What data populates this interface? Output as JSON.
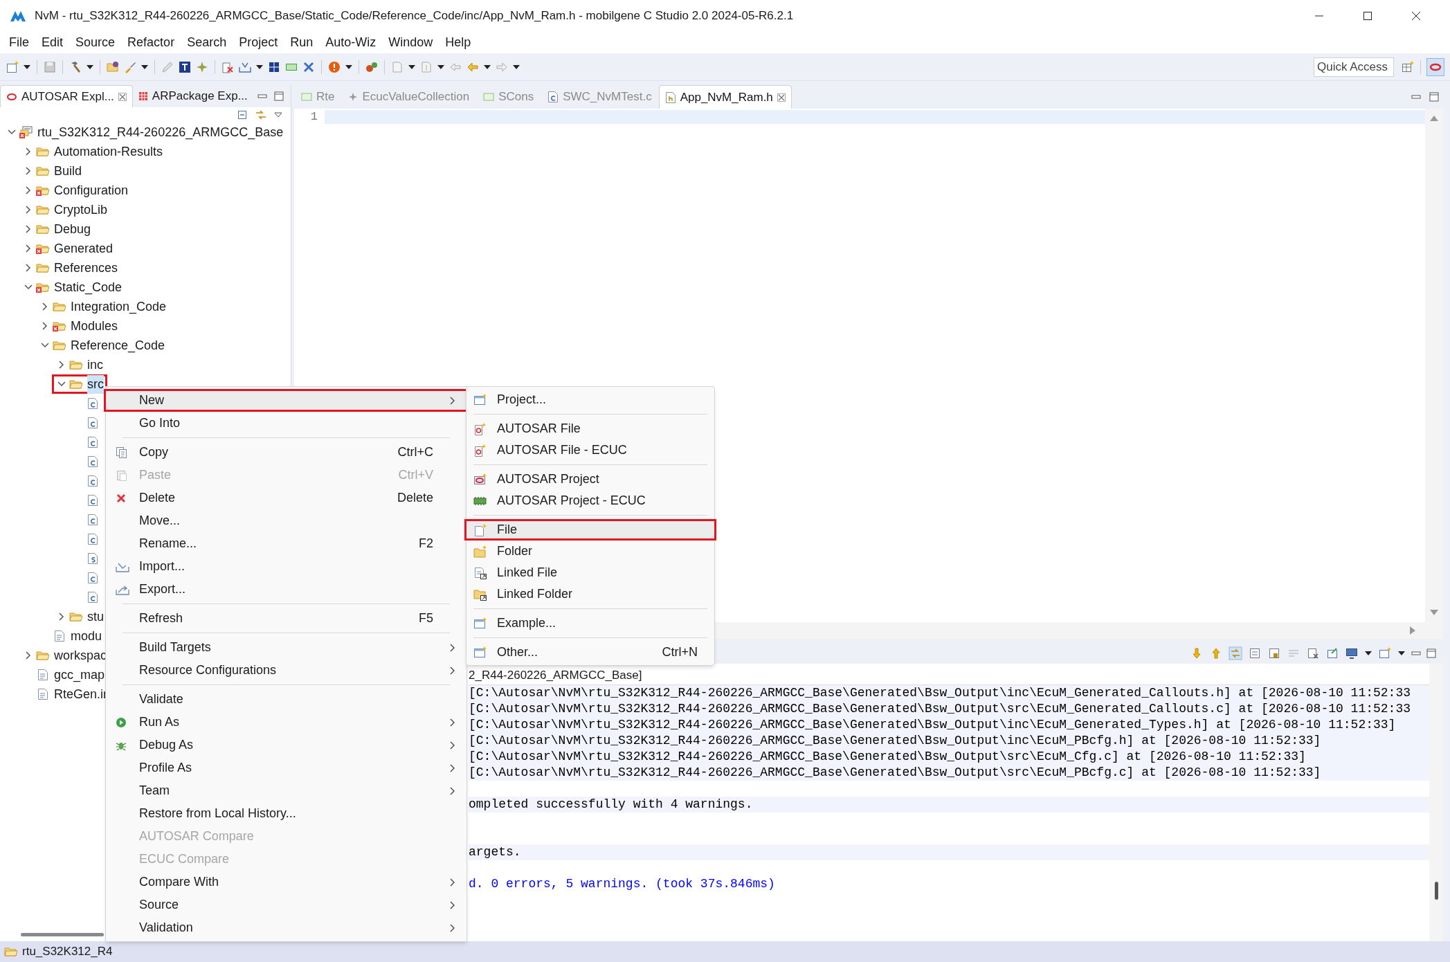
{
  "window": {
    "title": "NvM - rtu_S32K312_R44-260226_ARMGCC_Base/Static_Code/Reference_Code/inc/App_NvM_Ram.h - mobilgene C Studio 2.0 2024-05-R6.2.1"
  },
  "menu_bar": [
    "File",
    "Edit",
    "Source",
    "Refactor",
    "Search",
    "Project",
    "Run",
    "Auto-Wiz",
    "Window",
    "Help"
  ],
  "quick_access": {
    "placeholder": "Quick Access"
  },
  "left_panel": {
    "tabs": [
      {
        "label": "AUTOSAR Expl...",
        "selected": true
      },
      {
        "label": "ARPackage Exp...",
        "selected": false
      }
    ],
    "tree": [
      {
        "label": "rtu_S32K312_R44-260226_ARMGCC_Base",
        "kind": "project",
        "expanded": true,
        "error": true,
        "highlighted": false,
        "children": [
          {
            "label": "Automation-Results",
            "kind": "folder",
            "expanded": false,
            "error": false,
            "highlighted": false
          },
          {
            "label": "Build",
            "kind": "folder",
            "expanded": false,
            "error": false,
            "highlighted": false
          },
          {
            "label": "Configuration",
            "kind": "folder",
            "expanded": false,
            "error": true,
            "highlighted": false
          },
          {
            "label": "CryptoLib",
            "kind": "folder",
            "expanded": false,
            "error": false,
            "highlighted": false
          },
          {
            "label": "Debug",
            "kind": "folder",
            "expanded": false,
            "error": false,
            "highlighted": false
          },
          {
            "label": "Generated",
            "kind": "folder",
            "expanded": false,
            "error": true,
            "highlighted": false
          },
          {
            "label": "References",
            "kind": "folder",
            "expanded": false,
            "error": false,
            "highlighted": false
          },
          {
            "label": "Static_Code",
            "kind": "folder",
            "expanded": true,
            "error": true,
            "highlighted": false,
            "children": [
              {
                "label": "Integration_Code",
                "kind": "folder",
                "expanded": false,
                "error": false,
                "highlighted": false
              },
              {
                "label": "Modules",
                "kind": "folder",
                "expanded": false,
                "error": true,
                "highlighted": false
              },
              {
                "label": "Reference_Code",
                "kind": "folder",
                "expanded": true,
                "error": false,
                "highlighted": false,
                "children": [
                  {
                    "label": "inc",
                    "kind": "folder",
                    "expanded": false,
                    "error": false,
                    "highlighted": false
                  },
                  {
                    "label": "src",
                    "kind": "folder",
                    "expanded": true,
                    "error": false,
                    "highlighted": true,
                    "children": [
                      {
                        "kind": "c_file",
                        "highlighted": false
                      },
                      {
                        "kind": "c_file",
                        "highlighted": false
                      },
                      {
                        "kind": "c_file",
                        "highlighted": false
                      },
                      {
                        "kind": "c_file",
                        "highlighted": false
                      },
                      {
                        "kind": "c_file",
                        "highlighted": false
                      },
                      {
                        "kind": "c_file",
                        "highlighted": false
                      },
                      {
                        "kind": "c_file",
                        "highlighted": false
                      },
                      {
                        "kind": "c_file",
                        "highlighted": false
                      },
                      {
                        "kind": "asm_file",
                        "highlighted": false
                      },
                      {
                        "kind": "c_file",
                        "highlighted": false
                      },
                      {
                        "kind": "c_file",
                        "highlighted": false
                      }
                    ]
                  },
                  {
                    "label": "stu",
                    "kind": "folder",
                    "expanded": false,
                    "error": false,
                    "highlighted": false
                  }
                ]
              },
              {
                "label": "modu",
                "kind": "file",
                "highlighted": false
              }
            ]
          },
          {
            "label": "workspac",
            "kind": "folder",
            "expanded": false,
            "error": false,
            "highlighted": false
          },
          {
            "label": "gcc_map",
            "kind": "file",
            "highlighted": false
          },
          {
            "label": "RteGen.ir",
            "kind": "file",
            "highlighted": false
          }
        ]
      }
    ]
  },
  "editor": {
    "tabs": [
      {
        "label": "Rte",
        "selected": false
      },
      {
        "label": "EcucValueCollection",
        "selected": false
      },
      {
        "label": "SCons",
        "selected": false
      },
      {
        "label": "SWC_NvMTest.c",
        "selected": false
      },
      {
        "label": "App_NvM_Ram.h",
        "selected": true
      }
    ],
    "line_numbers": [
      "1"
    ]
  },
  "console": {
    "title": "2_R44-260226_ARMGCC_Base]",
    "lines": [
      {
        "kind": "text",
        "text": "[C:\\Autosar\\NvM\\rtu_S32K312_R44-260226_ARMGCC_Base\\Generated\\Bsw_Output\\inc\\EcuM_Generated_Callouts.h] at [2026-08-10 11:52:33",
        "shaded": true,
        "color": "#000000"
      },
      {
        "kind": "text",
        "text": "[C:\\Autosar\\NvM\\rtu_S32K312_R44-260226_ARMGCC_Base\\Generated\\Bsw_Output\\src\\EcuM_Generated_Callouts.c] at [2026-08-10 11:52:33",
        "shaded": true,
        "color": "#000000"
      },
      {
        "kind": "text",
        "text": "[C:\\Autosar\\NvM\\rtu_S32K312_R44-260226_ARMGCC_Base\\Generated\\Bsw_Output\\inc\\EcuM_Generated_Types.h] at [2026-08-10 11:52:33]",
        "shaded": true,
        "color": "#000000"
      },
      {
        "kind": "text",
        "text": "[C:\\Autosar\\NvM\\rtu_S32K312_R44-260226_ARMGCC_Base\\Generated\\Bsw_Output\\inc\\EcuM_PBcfg.h] at [2026-08-10 11:52:33]",
        "shaded": true,
        "color": "#000000"
      },
      {
        "kind": "text",
        "text": "[C:\\Autosar\\NvM\\rtu_S32K312_R44-260226_ARMGCC_Base\\Generated\\Bsw_Output\\src\\EcuM_Cfg.c] at [2026-08-10 11:52:33]",
        "shaded": true,
        "color": "#000000"
      },
      {
        "kind": "text",
        "text": "[C:\\Autosar\\NvM\\rtu_S32K312_R44-260226_ARMGCC_Base\\Generated\\Bsw_Output\\src\\EcuM_PBcfg.c] at [2026-08-10 11:52:33]",
        "shaded": true,
        "color": "#000000"
      },
      {
        "kind": "blank"
      },
      {
        "kind": "text",
        "text": "ompleted successfully with 4 warnings.",
        "shaded": true,
        "color": "#000000"
      },
      {
        "kind": "blank"
      },
      {
        "kind": "blank"
      },
      {
        "kind": "text",
        "text": "argets.",
        "shaded": true,
        "color": "#000000"
      },
      {
        "kind": "blank"
      },
      {
        "kind": "text",
        "text": "d. 0 errors, 5 warnings. (took 37s.846ms)",
        "shaded": false,
        "color": "#0000ff"
      }
    ]
  },
  "context_menu": [
    {
      "kind": "item",
      "label": "New",
      "submenu": true,
      "disabled": false,
      "highlighted": true
    },
    {
      "kind": "item",
      "label": "Go Into",
      "submenu": false,
      "disabled": false,
      "highlighted": false
    },
    {
      "kind": "separator"
    },
    {
      "kind": "item",
      "label": "Copy",
      "shortcut": "Ctrl+C",
      "submenu": false,
      "disabled": false,
      "highlighted": false
    },
    {
      "kind": "item",
      "label": "Paste",
      "shortcut": "Ctrl+V",
      "submenu": false,
      "disabled": true,
      "highlighted": false
    },
    {
      "kind": "item",
      "label": "Delete",
      "shortcut": "Delete",
      "submenu": false,
      "disabled": false,
      "highlighted": false
    },
    {
      "kind": "item",
      "label": "Move...",
      "submenu": false,
      "disabled": false,
      "highlighted": false
    },
    {
      "kind": "item",
      "label": "Rename...",
      "shortcut": "F2",
      "submenu": false,
      "disabled": false,
      "highlighted": false
    },
    {
      "kind": "item",
      "label": "Import...",
      "submenu": false,
      "disabled": false,
      "highlighted": false
    },
    {
      "kind": "item",
      "label": "Export...",
      "submenu": false,
      "disabled": false,
      "highlighted": false
    },
    {
      "kind": "separator"
    },
    {
      "kind": "item",
      "label": "Refresh",
      "shortcut": "F5",
      "submenu": false,
      "disabled": false,
      "highlighted": false
    },
    {
      "kind": "separator"
    },
    {
      "kind": "item",
      "label": "Build Targets",
      "submenu": true,
      "disabled": false,
      "highlighted": false
    },
    {
      "kind": "item",
      "label": "Resource Configurations",
      "submenu": true,
      "disabled": false,
      "highlighted": false
    },
    {
      "kind": "separator"
    },
    {
      "kind": "item",
      "label": "Validate",
      "submenu": false,
      "disabled": false,
      "highlighted": false
    },
    {
      "kind": "item",
      "label": "Run As",
      "submenu": true,
      "disabled": false,
      "highlighted": false
    },
    {
      "kind": "item",
      "label": "Debug As",
      "submenu": true,
      "disabled": false,
      "highlighted": false
    },
    {
      "kind": "item",
      "label": "Profile As",
      "submenu": true,
      "disabled": false,
      "highlighted": false
    },
    {
      "kind": "item",
      "label": "Team",
      "submenu": true,
      "disabled": false,
      "highlighted": false
    },
    {
      "kind": "item",
      "label": "Restore from Local History...",
      "submenu": false,
      "disabled": false,
      "highlighted": false
    },
    {
      "kind": "item",
      "label": "AUTOSAR Compare",
      "submenu": false,
      "disabled": true,
      "highlighted": false
    },
    {
      "kind": "item",
      "label": "ECUC Compare",
      "submenu": false,
      "disabled": true,
      "highlighted": false
    },
    {
      "kind": "item",
      "label": "Compare With",
      "submenu": true,
      "disabled": false,
      "highlighted": false
    },
    {
      "kind": "item",
      "label": "Source",
      "submenu": true,
      "disabled": false,
      "highlighted": false
    },
    {
      "kind": "item",
      "label": "Validation",
      "submenu": true,
      "disabled": false,
      "highlighted": false
    }
  ],
  "new_submenu": [
    {
      "kind": "item",
      "label": "Project...",
      "highlighted": false
    },
    {
      "kind": "separator"
    },
    {
      "kind": "item",
      "label": "AUTOSAR File",
      "highlighted": false
    },
    {
      "kind": "item",
      "label": "AUTOSAR File - ECUC",
      "highlighted": false
    },
    {
      "kind": "separator"
    },
    {
      "kind": "item",
      "label": "AUTOSAR Project",
      "highlighted": false
    },
    {
      "kind": "item",
      "label": "AUTOSAR Project - ECUC",
      "highlighted": false
    },
    {
      "kind": "separator"
    },
    {
      "kind": "item",
      "label": "File",
      "highlighted": true
    },
    {
      "kind": "item",
      "label": "Folder",
      "highlighted": false
    },
    {
      "kind": "item",
      "label": "Linked File",
      "highlighted": false
    },
    {
      "kind": "item",
      "label": "Linked Folder",
      "highlighted": false
    },
    {
      "kind": "separator"
    },
    {
      "kind": "item",
      "label": "Example...",
      "highlighted": false
    },
    {
      "kind": "separator"
    },
    {
      "kind": "item",
      "label": "Other...",
      "shortcut": "Ctrl+N",
      "highlighted": false
    }
  ],
  "status_bar": {
    "text": "rtu_S32K312_R4"
  }
}
